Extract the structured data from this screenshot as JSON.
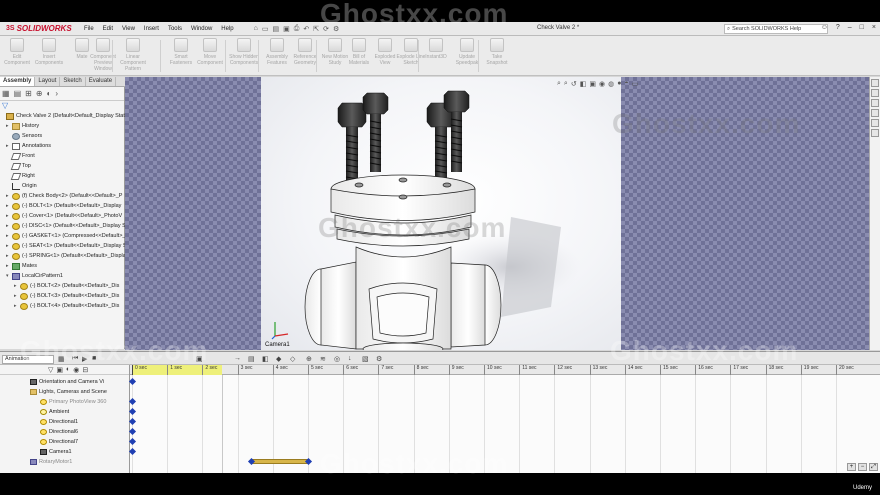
{
  "app": {
    "logo_prefix": "3S",
    "logo_text": "SOLIDWORKS",
    "document_title": "Check Valve 2 *",
    "search_label": "Search SOLIDWORKS Help",
    "menus": [
      "File",
      "Edit",
      "View",
      "Insert",
      "Tools",
      "Window",
      "Help"
    ]
  },
  "commands": [
    {
      "label": "Edit Component"
    },
    {
      "label": "Insert Components"
    },
    {
      "label": "Mate"
    },
    {
      "label": "Component Preview Window"
    },
    {
      "label": "Linear Component Pattern"
    },
    {
      "label": "Smart Fasteners"
    },
    {
      "label": "Move Component"
    },
    {
      "label": "Show Hidden Components"
    },
    {
      "label": "Assembly Features"
    },
    {
      "label": "Reference Geometry"
    },
    {
      "label": "New Motion Study"
    },
    {
      "label": "Bill of Materials"
    },
    {
      "label": "Exploded View"
    },
    {
      "label": "Explode Line Sketch"
    },
    {
      "label": "Instant3D"
    },
    {
      "label": "Update Speedpak"
    },
    {
      "label": "Take Snapshot"
    }
  ],
  "tabs": [
    "Assembly",
    "Layout",
    "Sketch",
    "Evaluate"
  ],
  "tree": [
    {
      "label": "Check Valve 2  (Default<Default_Display State-",
      "icon": "asm",
      "expand": ""
    },
    {
      "label": "History",
      "icon": "folder",
      "expand": "▸"
    },
    {
      "label": "Sensors",
      "icon": "sensor",
      "expand": ""
    },
    {
      "label": "Annotations",
      "icon": "ann",
      "expand": "▸"
    },
    {
      "label": "Front",
      "icon": "plane",
      "expand": ""
    },
    {
      "label": "Top",
      "icon": "plane",
      "expand": ""
    },
    {
      "label": "Right",
      "icon": "plane",
      "expand": ""
    },
    {
      "label": "Origin",
      "icon": "origin",
      "expand": ""
    },
    {
      "label": "(f) Check Body<2> (Default<<Default>_P",
      "icon": "part",
      "expand": "▸"
    },
    {
      "label": "(-) BOLT<1> (Default<<Default>_Display",
      "icon": "part",
      "expand": "▸"
    },
    {
      "label": "(-) Cover<1> (Default<<Default>_PhotoV",
      "icon": "part",
      "expand": "▸"
    },
    {
      "label": "(-) DISC<1> (Default<<Default>_Display S",
      "icon": "part",
      "expand": "▸"
    },
    {
      "label": "(-) GASKET<1> (Compressed<<Default>_",
      "icon": "part",
      "expand": "▸"
    },
    {
      "label": "(-) SEAT<1> (Default<<Default>_Display S",
      "icon": "part",
      "expand": "▸"
    },
    {
      "label": "(-) SPRING<1> (Default<<Default>_Displa",
      "icon": "part",
      "expand": "▸"
    },
    {
      "label": "Mates",
      "icon": "mates",
      "expand": "▸"
    },
    {
      "label": "LocalCirPattern1",
      "icon": "pattern",
      "expand": "▾"
    },
    {
      "label": "(-) BOLT<2> (Default<<Default>_Dis",
      "icon": "part",
      "expand": "▸"
    },
    {
      "label": "(-) BOLT<3> (Default<<Default>_Dis",
      "icon": "part",
      "expand": "▸"
    },
    {
      "label": "(-) BOLT<4> (Default<<Default>_Dis",
      "icon": "part",
      "expand": "▸"
    }
  ],
  "viewport": {
    "camera_label": "Camera1"
  },
  "motion": {
    "study_type": "Animation",
    "items": [
      {
        "label": "Orientation and Camera Vi",
        "icon": "cam",
        "indent": 0,
        "grey": false
      },
      {
        "label": "Lights, Cameras and Scene",
        "icon": "folder",
        "indent": 0,
        "grey": false
      },
      {
        "label": "Primary PhotoView 360",
        "icon": "light",
        "indent": 1,
        "grey": true
      },
      {
        "label": "Ambient",
        "icon": "ambient",
        "indent": 1,
        "grey": false
      },
      {
        "label": "Directional1",
        "icon": "light",
        "indent": 1,
        "grey": false
      },
      {
        "label": "Directional6",
        "icon": "light",
        "indent": 1,
        "grey": false
      },
      {
        "label": "Directional7",
        "icon": "light",
        "indent": 1,
        "grey": false
      },
      {
        "label": "Camera1",
        "icon": "cam",
        "indent": 1,
        "grey": false
      },
      {
        "label": "RotaryMotor1",
        "icon": "pattern",
        "indent": 0,
        "grey": true
      }
    ],
    "ticks": [
      "0 sec",
      "1 sec",
      "2 sec",
      "3 sec",
      "4 sec",
      "5 sec",
      "6 sec",
      "7 sec",
      "8 sec",
      "9 sec",
      "10 sec",
      "11 sec",
      "12 sec",
      "13 sec",
      "14 sec",
      "15 sec",
      "16 sec",
      "17 sec",
      "18 sec",
      "19 sec",
      "20 sec"
    ],
    "key_rows": [
      0,
      2,
      3,
      4,
      5,
      6,
      7
    ],
    "motor_key_start_sec": 3.4,
    "motor_key_end_sec": 5.0
  },
  "overlay": {
    "udemy": "Udemy",
    "watermark": "Ghostxx.com"
  }
}
